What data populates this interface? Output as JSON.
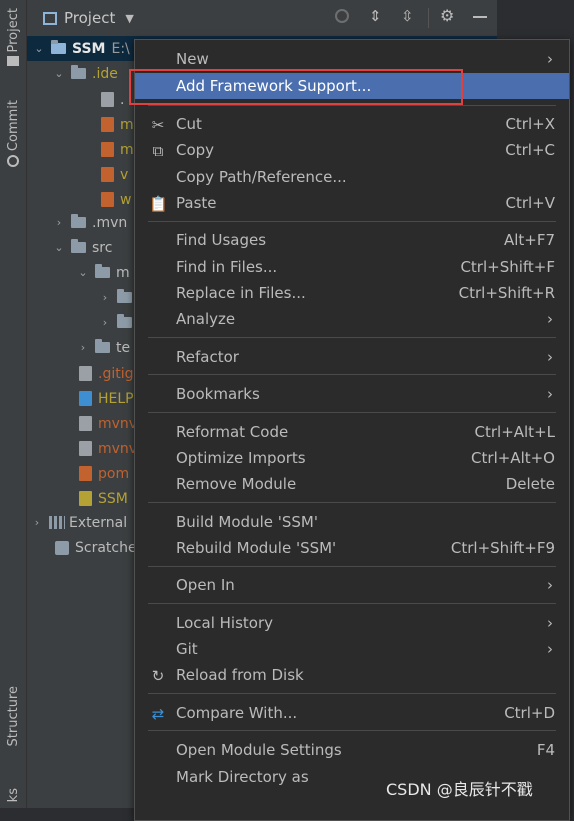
{
  "strip": {
    "project": "Project",
    "commit": "Commit",
    "structure": "Structure",
    "bookmarks": "ks"
  },
  "panel": {
    "title": "Project"
  },
  "tree": {
    "root": {
      "name": "SSM",
      "path": "E:\\"
    },
    "items": [
      {
        "label": ".ide"
      },
      {
        "label": "."
      },
      {
        "label": "m"
      },
      {
        "label": "m"
      },
      {
        "label": "v"
      },
      {
        "label": "w"
      },
      {
        "label": ".mvn"
      },
      {
        "label": "src"
      },
      {
        "label": "m"
      },
      {
        "label": ""
      },
      {
        "label": ""
      },
      {
        "label": "te"
      },
      {
        "label": ".gitig"
      },
      {
        "label": "HELP"
      },
      {
        "label": "mvnv"
      },
      {
        "label": "mvnv"
      },
      {
        "label": "pom"
      },
      {
        "label": "SSM"
      },
      {
        "label": "External"
      },
      {
        "label": "Scratche"
      }
    ]
  },
  "menu": {
    "new": "New",
    "add_framework": "Add Framework Support...",
    "cut": "Cut",
    "cut_sc": "Ctrl+X",
    "copy": "Copy",
    "copy_sc": "Ctrl+C",
    "copy_path": "Copy Path/Reference...",
    "paste": "Paste",
    "paste_sc": "Ctrl+V",
    "find_usages": "Find Usages",
    "find_usages_sc": "Alt+F7",
    "find_in_files": "Find in Files...",
    "find_in_files_sc": "Ctrl+Shift+F",
    "replace_in_files": "Replace in Files...",
    "replace_in_files_sc": "Ctrl+Shift+R",
    "analyze": "Analyze",
    "refactor": "Refactor",
    "bookmarks": "Bookmarks",
    "reformat": "Reformat Code",
    "reformat_sc": "Ctrl+Alt+L",
    "optimize": "Optimize Imports",
    "optimize_sc": "Ctrl+Alt+O",
    "remove_module": "Remove Module",
    "remove_module_sc": "Delete",
    "build_module": "Build Module 'SSM'",
    "rebuild_module": "Rebuild Module 'SSM'",
    "rebuild_module_sc": "Ctrl+Shift+F9",
    "open_in": "Open In",
    "local_history": "Local History",
    "git": "Git",
    "reload": "Reload from Disk",
    "compare": "Compare With...",
    "compare_sc": "Ctrl+D",
    "module_settings": "Open Module Settings",
    "module_settings_sc": "F4",
    "mark_dir": "Mark Directory as"
  },
  "watermark": "CSDN @良辰针不戳"
}
